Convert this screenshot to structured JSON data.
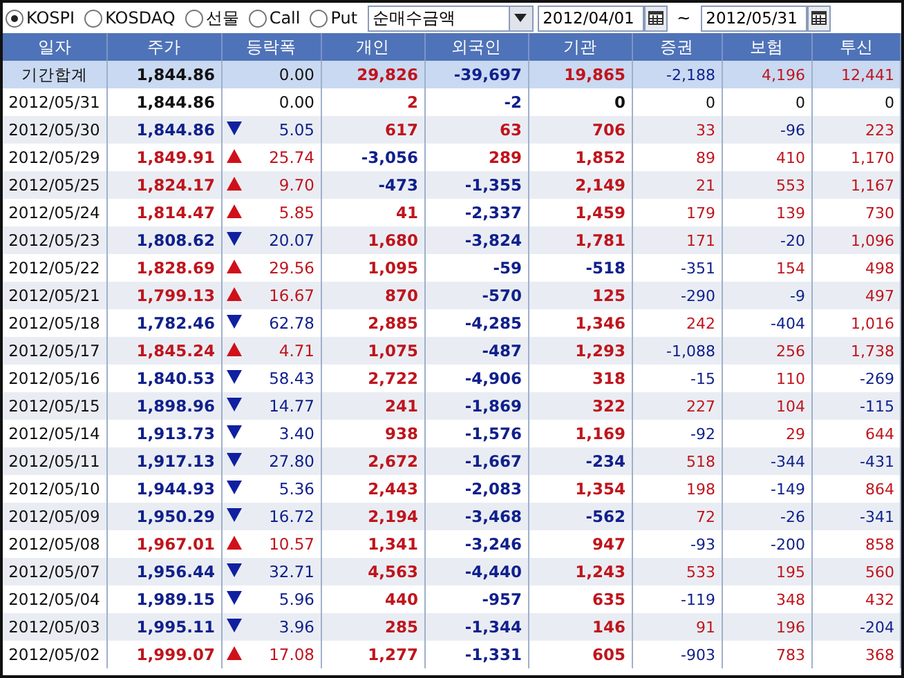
{
  "toolbar": {
    "markets": [
      {
        "label": "KOSPI",
        "selected": true
      },
      {
        "label": "KOSDAQ",
        "selected": false
      },
      {
        "label": "선물",
        "selected": false
      },
      {
        "label": "Call",
        "selected": false
      },
      {
        "label": "Put",
        "selected": false
      }
    ],
    "measure": "순매수금액",
    "start_date": "2012/04/01",
    "separator": "~",
    "end_date": "2012/05/31"
  },
  "table": {
    "columns": [
      "일자",
      "주가",
      "등락폭",
      "개인",
      "외국인",
      "기관",
      "증권",
      "보험",
      "투신"
    ],
    "summary": {
      "date": "기간합계",
      "price": "1,844.86",
      "kind": "flat",
      "change": "0.00",
      "values": [
        "29,826",
        "-39,697",
        "19,865",
        "-2,188",
        "4,196",
        "12,441"
      ]
    },
    "rows": [
      {
        "date": "2012/05/31",
        "price": "1,844.86",
        "kind": "flat",
        "change": "0.00",
        "values": [
          "2",
          "-2",
          "0",
          "0",
          "0",
          "0"
        ]
      },
      {
        "date": "2012/05/30",
        "price": "1,844.86",
        "kind": "down",
        "change": "5.05",
        "values": [
          "617",
          "63",
          "706",
          "33",
          "-96",
          "223"
        ]
      },
      {
        "date": "2012/05/29",
        "price": "1,849.91",
        "kind": "up",
        "change": "25.74",
        "values": [
          "-3,056",
          "289",
          "1,852",
          "89",
          "410",
          "1,170"
        ]
      },
      {
        "date": "2012/05/25",
        "price": "1,824.17",
        "kind": "up",
        "change": "9.70",
        "values": [
          "-473",
          "-1,355",
          "2,149",
          "21",
          "553",
          "1,167"
        ]
      },
      {
        "date": "2012/05/24",
        "price": "1,814.47",
        "kind": "up",
        "change": "5.85",
        "values": [
          "41",
          "-2,337",
          "1,459",
          "179",
          "139",
          "730"
        ]
      },
      {
        "date": "2012/05/23",
        "price": "1,808.62",
        "kind": "down",
        "change": "20.07",
        "values": [
          "1,680",
          "-3,824",
          "1,781",
          "171",
          "-20",
          "1,096"
        ]
      },
      {
        "date": "2012/05/22",
        "price": "1,828.69",
        "kind": "up",
        "change": "29.56",
        "values": [
          "1,095",
          "-59",
          "-518",
          "-351",
          "154",
          "498"
        ]
      },
      {
        "date": "2012/05/21",
        "price": "1,799.13",
        "kind": "up",
        "change": "16.67",
        "values": [
          "870",
          "-570",
          "125",
          "-290",
          "-9",
          "497"
        ]
      },
      {
        "date": "2012/05/18",
        "price": "1,782.46",
        "kind": "down",
        "change": "62.78",
        "values": [
          "2,885",
          "-4,285",
          "1,346",
          "242",
          "-404",
          "1,016"
        ]
      },
      {
        "date": "2012/05/17",
        "price": "1,845.24",
        "kind": "up",
        "change": "4.71",
        "values": [
          "1,075",
          "-487",
          "1,293",
          "-1,088",
          "256",
          "1,738"
        ]
      },
      {
        "date": "2012/05/16",
        "price": "1,840.53",
        "kind": "down",
        "change": "58.43",
        "values": [
          "2,722",
          "-4,906",
          "318",
          "-15",
          "110",
          "-269"
        ]
      },
      {
        "date": "2012/05/15",
        "price": "1,898.96",
        "kind": "down",
        "change": "14.77",
        "values": [
          "241",
          "-1,869",
          "322",
          "227",
          "104",
          "-115"
        ]
      },
      {
        "date": "2012/05/14",
        "price": "1,913.73",
        "kind": "down",
        "change": "3.40",
        "values": [
          "938",
          "-1,576",
          "1,169",
          "-92",
          "29",
          "644"
        ]
      },
      {
        "date": "2012/05/11",
        "price": "1,917.13",
        "kind": "down",
        "change": "27.80",
        "values": [
          "2,672",
          "-1,667",
          "-234",
          "518",
          "-344",
          "-431"
        ]
      },
      {
        "date": "2012/05/10",
        "price": "1,944.93",
        "kind": "down",
        "change": "5.36",
        "values": [
          "2,443",
          "-2,083",
          "1,354",
          "198",
          "-149",
          "864"
        ]
      },
      {
        "date": "2012/05/09",
        "price": "1,950.29",
        "kind": "down",
        "change": "16.72",
        "values": [
          "2,194",
          "-3,468",
          "-562",
          "72",
          "-26",
          "-341"
        ]
      },
      {
        "date": "2012/05/08",
        "price": "1,967.01",
        "kind": "up",
        "change": "10.57",
        "values": [
          "1,341",
          "-3,246",
          "947",
          "-93",
          "-200",
          "858"
        ]
      },
      {
        "date": "2012/05/07",
        "price": "1,956.44",
        "kind": "down",
        "change": "32.71",
        "values": [
          "4,563",
          "-4,440",
          "1,243",
          "533",
          "195",
          "560"
        ]
      },
      {
        "date": "2012/05/04",
        "price": "1,989.15",
        "kind": "down",
        "change": "5.96",
        "values": [
          "440",
          "-957",
          "635",
          "-119",
          "348",
          "432"
        ]
      },
      {
        "date": "2012/05/03",
        "price": "1,995.11",
        "kind": "down",
        "change": "3.96",
        "values": [
          "285",
          "-1,344",
          "146",
          "91",
          "196",
          "-204"
        ]
      },
      {
        "date": "2012/05/02",
        "price": "1,999.07",
        "kind": "up",
        "change": "17.08",
        "values": [
          "1,277",
          "-1,331",
          "605",
          "-903",
          "783",
          "368"
        ]
      }
    ]
  }
}
